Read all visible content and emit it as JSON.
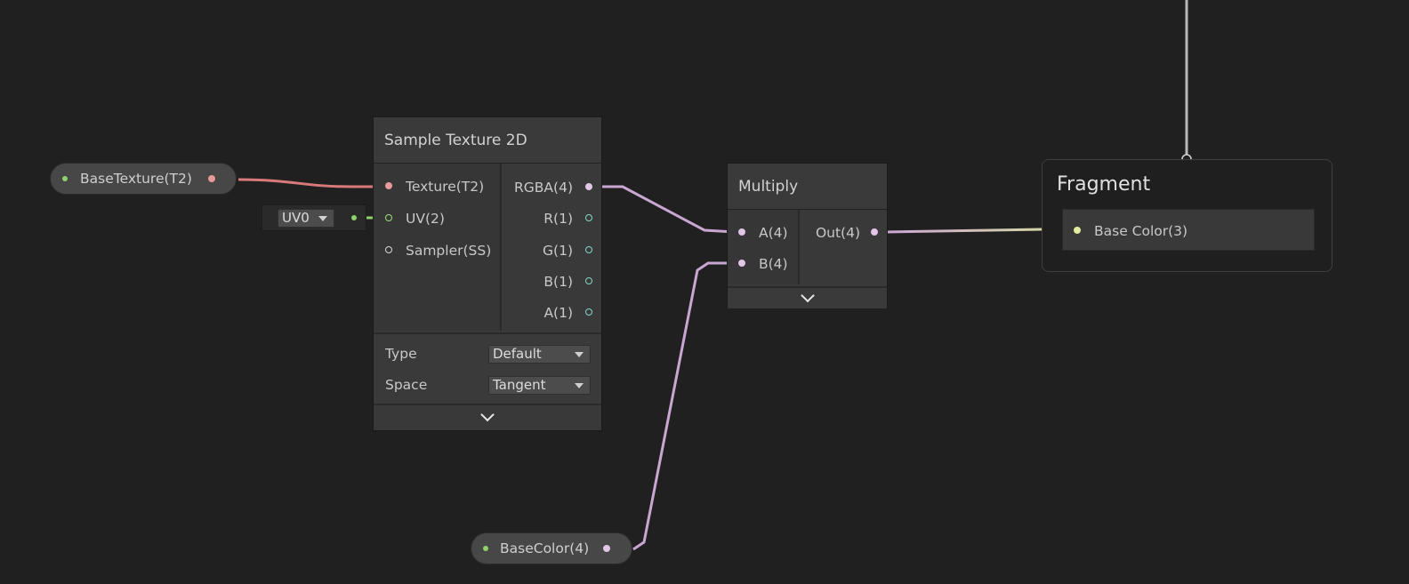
{
  "colors": {
    "background": "#202020",
    "texture_wire": "#d97a7a",
    "uv_wire": "#8fd16a",
    "vector4_wire": "#caa6d2",
    "vector3_wire": "#d8df9e",
    "master_wire": "#b8b8b8"
  },
  "properties": {
    "base_texture": {
      "label": "BaseTexture(T2)"
    },
    "base_color": {
      "label": "BaseColor(4)"
    }
  },
  "uv_dropdown": {
    "value": "UV0"
  },
  "sample_texture": {
    "title": "Sample Texture 2D",
    "inputs": [
      "Texture(T2)",
      "UV(2)",
      "Sampler(SS)"
    ],
    "outputs": [
      "RGBA(4)",
      "R(1)",
      "G(1)",
      "B(1)",
      "A(1)"
    ],
    "type_label": "Type",
    "type_value": "Default",
    "space_label": "Space",
    "space_value": "Tangent"
  },
  "multiply": {
    "title": "Multiply",
    "inputs": [
      "A(4)",
      "B(4)"
    ],
    "output": "Out(4)"
  },
  "fragment": {
    "title": "Fragment",
    "slot": "Base Color(3)"
  }
}
